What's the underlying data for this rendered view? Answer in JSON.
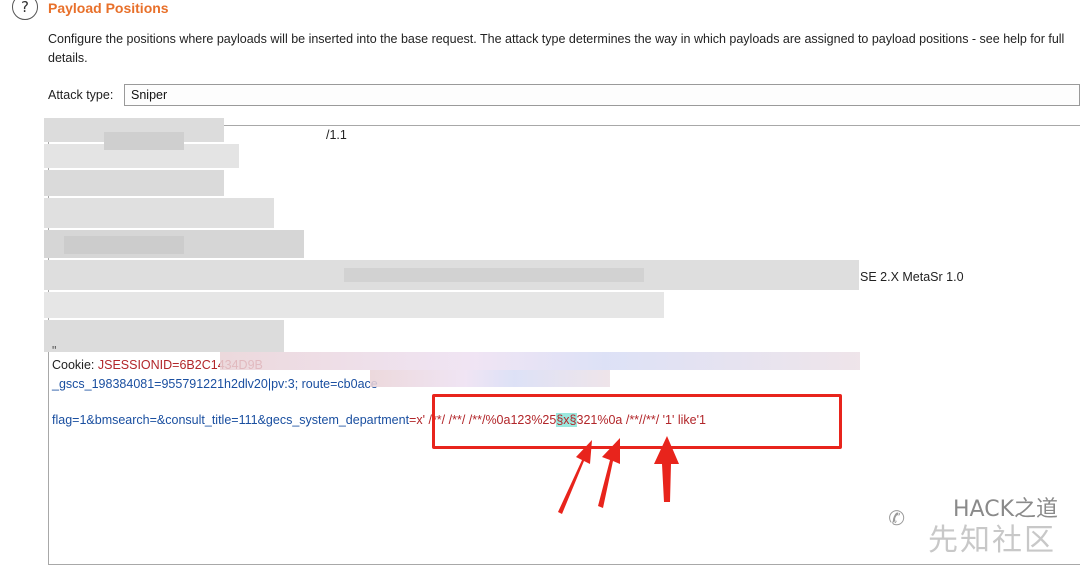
{
  "header": {
    "help_icon": "?",
    "title": "Payload Positions",
    "description": "Configure the positions where payloads will be inserted into the base request. The attack type determines the way in which payloads are assigned to payload positions - see help for full details."
  },
  "attack": {
    "label": "Attack type:",
    "value": "Sniper"
  },
  "request": {
    "line1_suffix": "/1.1",
    "line_agent_suffix": "SE 2.X MetaSr 1.0",
    "line_small": "\"",
    "cookie_label": "Cookie: ",
    "cookie_value": "JSESSIONID=6B2C1434D9B",
    "cookie_line2_value": "_gscs_198384081=955791221h2dlv20|pv:3; route=cb0ace",
    "body_prefix": "flag=1&bmsearch=&consult_title=111&gecs_system_department",
    "body_eq": "=",
    "body_value_a": "x' /**/ /**/ /**/%0a123%25",
    "body_marker": "§x§",
    "body_value_b": "321%0a /**//**/ '1' like'1"
  },
  "watermark": {
    "icon": "chat-icon",
    "text": "HACK之道",
    "text2": "先知社区"
  },
  "colors": {
    "title": "#e8702a",
    "param_name": "#1a4fa0",
    "param_value": "#b2262a",
    "payload_marker_bg": "#9be8de",
    "annotation": "#e8241c"
  }
}
